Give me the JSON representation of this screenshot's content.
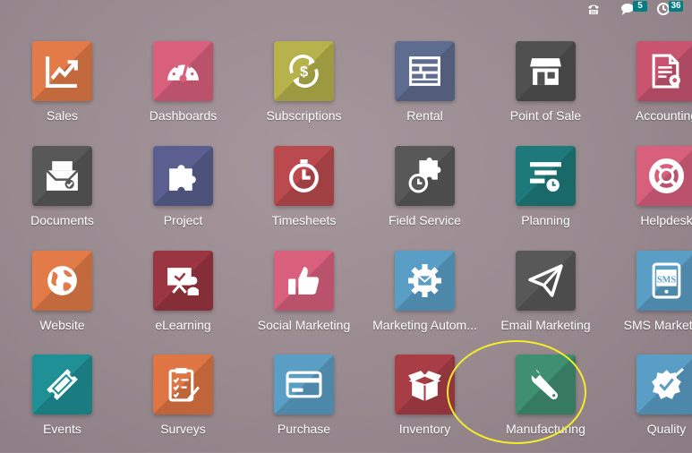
{
  "topbar": {
    "phone_icon": "phone-icon",
    "chat_icon": "chat-icon",
    "chat_count": "5",
    "activity_icon": "clock-icon",
    "activity_count": "36"
  },
  "apps": [
    {
      "label": "Sales",
      "icon": "trend-chart-icon",
      "color": "#e27b48"
    },
    {
      "label": "Dashboards",
      "icon": "speedometer-icon",
      "color": "#d8607d"
    },
    {
      "label": "Subscriptions",
      "icon": "dollar-cycle-icon",
      "color": "#b7b24b"
    },
    {
      "label": "Rental",
      "icon": "rental-board-icon",
      "color": "#5e6c8f"
    },
    {
      "label": "Point of Sale",
      "icon": "storefront-icon",
      "color": "#505050"
    },
    {
      "label": "Accounting",
      "icon": "invoice-gear-icon",
      "color": "#c8546f"
    },
    {
      "label": "Documents",
      "icon": "inbox-tray-icon",
      "color": "#585858"
    },
    {
      "label": "Project",
      "icon": "puzzle-icon",
      "color": "#5a5f8f"
    },
    {
      "label": "Timesheets",
      "icon": "stopwatch-icon",
      "color": "#bb4a4e"
    },
    {
      "label": "Field Service",
      "icon": "puzzle-timer-icon",
      "color": "#585858"
    },
    {
      "label": "Planning",
      "icon": "planning-icon",
      "color": "#1e7a7a"
    },
    {
      "label": "Helpdesk",
      "icon": "lifebuoy-icon",
      "color": "#d8607d"
    },
    {
      "label": "Website",
      "icon": "globe-icon",
      "color": "#e27b48"
    },
    {
      "label": "eLearning",
      "icon": "presentation-icon",
      "color": "#9b3541"
    },
    {
      "label": "Social Marketing",
      "icon": "thumbs-up-icon",
      "color": "#d8607d"
    },
    {
      "label": "Marketing Autom...",
      "icon": "gear-mail-icon",
      "color": "#5a9ec6"
    },
    {
      "label": "Email Marketing",
      "icon": "paper-plane-icon",
      "color": "#585858"
    },
    {
      "label": "SMS Marketing",
      "icon": "sms-phone-icon",
      "color": "#5a9ec6"
    },
    {
      "label": "Events",
      "icon": "ticket-icon",
      "color": "#1e9096"
    },
    {
      "label": "Surveys",
      "icon": "clipboard-check-icon",
      "color": "#e07544"
    },
    {
      "label": "Purchase",
      "icon": "credit-card-icon",
      "color": "#5a9ec6"
    },
    {
      "label": "Inventory",
      "icon": "open-box-icon",
      "color": "#a93d46"
    },
    {
      "label": "Manufacturing",
      "icon": "wrench-icon",
      "color": "#3f8f71"
    },
    {
      "label": "Quality",
      "icon": "badge-check-icon",
      "color": "#5a9ec6"
    }
  ]
}
